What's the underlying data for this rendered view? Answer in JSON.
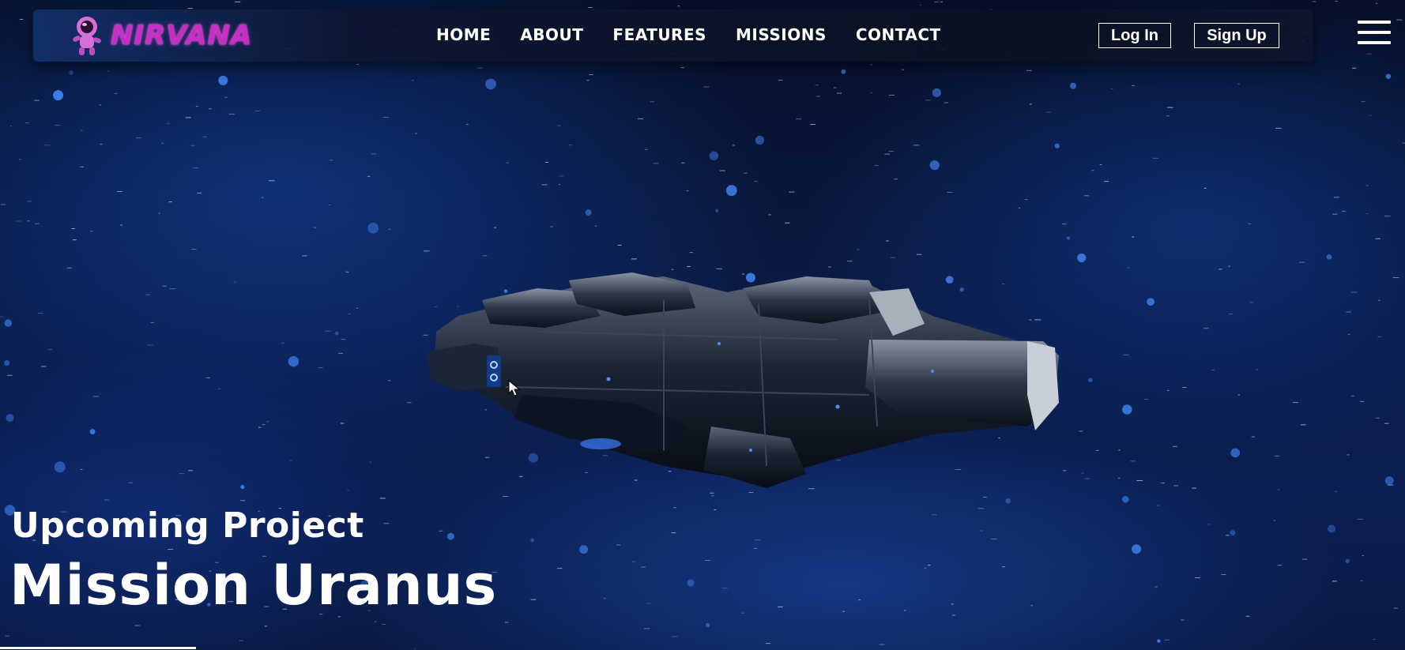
{
  "brand": {
    "name": "NIRVANA",
    "icon": "astronaut-icon",
    "color": "#c72fc2"
  },
  "nav": {
    "links": [
      "HOME",
      "ABOUT",
      "FEATURES",
      "MISSIONS",
      "CONTACT"
    ]
  },
  "auth": {
    "login_label": "Log In",
    "signup_label": "Sign Up"
  },
  "menu": {
    "icon": "hamburger-menu-icon"
  },
  "hero": {
    "subtitle": "Upcoming Project",
    "title": "Mission Uranus",
    "background": "space-nebula-with-spaceship",
    "slide_progress": 1.0
  },
  "colors": {
    "accent": "#c72fc2",
    "space_glow": "#1f6cff",
    "text": "#ffffff"
  }
}
